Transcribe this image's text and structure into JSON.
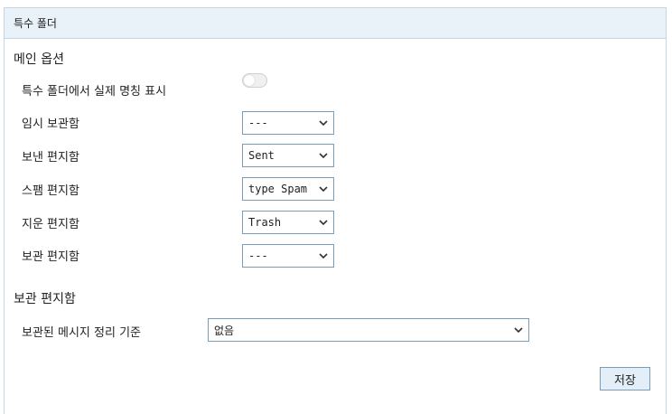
{
  "header": {
    "title": "특수 폴더"
  },
  "main_options": {
    "title": "메인 옵션",
    "show_real_names": {
      "label": "특수 폴더에서 실제 명칭 표시",
      "enabled": false
    },
    "rows": [
      {
        "label": "임시 보관함",
        "value": "---"
      },
      {
        "label": "보낸 편지함",
        "value": "Sent"
      },
      {
        "label": "스팸 편지함",
        "value": "type Spam"
      },
      {
        "label": "지운 편지함",
        "value": "Trash"
      },
      {
        "label": "보관 편지함",
        "value": "---"
      }
    ]
  },
  "archive": {
    "title": "보관 편지함",
    "organize": {
      "label": "보관된 메시지 정리 기준",
      "value": "없음"
    }
  },
  "footer": {
    "save_label": "저장"
  },
  "icons": {
    "select_arrow": "chevron-down-icon"
  }
}
